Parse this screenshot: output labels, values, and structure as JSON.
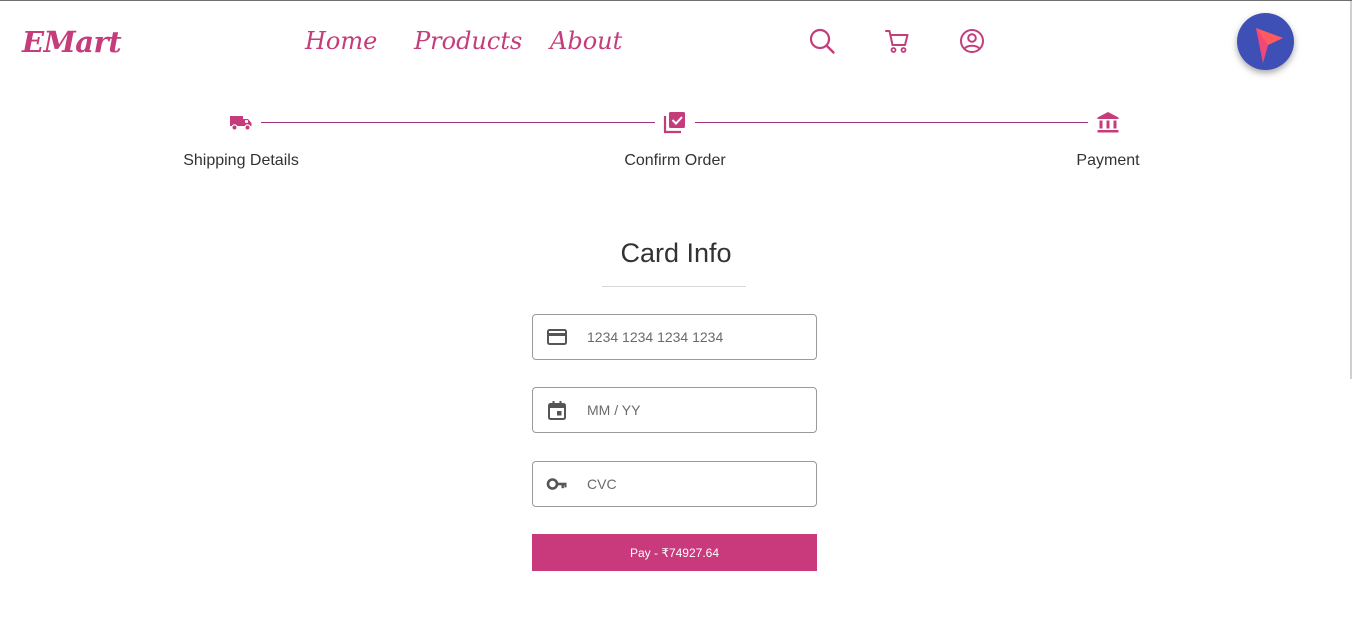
{
  "header": {
    "logo": "EMart",
    "nav": {
      "home": "Home",
      "products": "Products",
      "about": "About"
    },
    "icons": [
      "search-icon",
      "cart-icon",
      "account-icon"
    ],
    "fab_icon": "play-navigation-icon"
  },
  "stepper": {
    "steps": [
      {
        "label": "Shipping Details",
        "icon": "truck-icon"
      },
      {
        "label": "Confirm Order",
        "icon": "library-add-check-icon"
      },
      {
        "label": "Payment",
        "icon": "bank-icon"
      }
    ],
    "active_color": "#c53c7b"
  },
  "card_info": {
    "title": "Card Info",
    "card_number": {
      "placeholder": "1234 1234 1234 1234",
      "value": "",
      "icon": "credit-card-icon"
    },
    "expiry": {
      "placeholder": "MM / YY",
      "value": "",
      "icon": "calendar-icon"
    },
    "cvc": {
      "placeholder": "CVC",
      "value": "",
      "icon": "key-icon"
    },
    "pay_button": "Pay - ₹74927.64"
  },
  "colors": {
    "brand": "#c53c7b",
    "button": "#c93a7c",
    "fab": "#3e4fb5"
  }
}
